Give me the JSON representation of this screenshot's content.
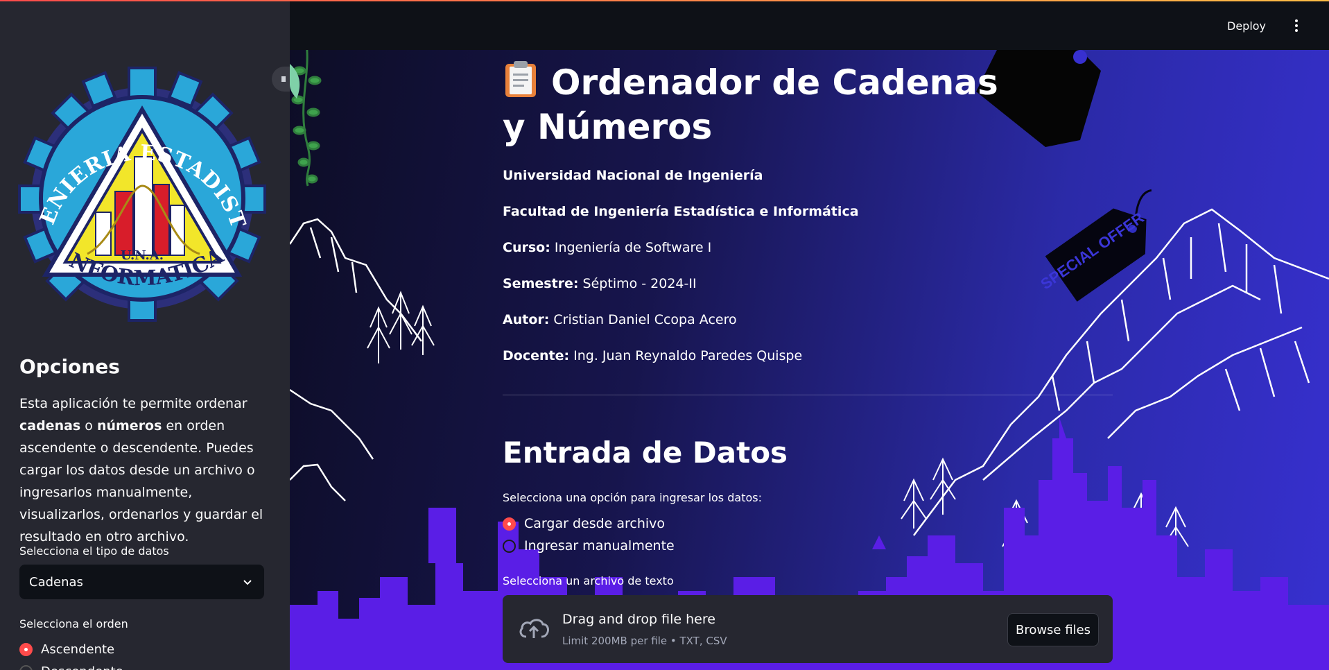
{
  "header": {
    "deploy_label": "Deploy"
  },
  "sidebar": {
    "logo": {
      "text_top": "INGENIERIA ESTADISTICA",
      "text_mid": "U.N.A.",
      "text_bottom": "INFORMATICA",
      "colors": {
        "outer": "#2c2f7a",
        "ring": "#2aa7d9",
        "yellow": "#f2e62a",
        "red": "#d81d2a"
      }
    },
    "title": "Opciones",
    "description": {
      "t1": "Esta aplicación te permite ordenar ",
      "b1": "cadenas",
      "t2": " o ",
      "b2": "números",
      "t3": " en orden ascendente o descendente. Puedes cargar los datos desde un archivo o ingresarlos manualmente, visualizarlos, ordenarlos y guardar el resultado en otro archivo."
    },
    "data_type_label": "Selecciona el tipo de datos",
    "data_type_value": "Cadenas",
    "order_label": "Selecciona el orden",
    "order_options": [
      "Ascendente",
      "Descendente"
    ],
    "order_selected": 0
  },
  "main": {
    "title": "Ordenador de Cadenas y Números",
    "title_emoji_icon": "clipboard-icon",
    "university": "Universidad Nacional de Ingeniería",
    "faculty": "Facultad de Ingeniería Estadística e Informática",
    "course": {
      "label": "Curso:",
      "value": " Ingeniería de Software I"
    },
    "semester": {
      "label": "Semestre:",
      "value": " Séptimo - 2024-II"
    },
    "author": {
      "label": "Autor:",
      "value": " Cristian Daniel Ccopa Acero"
    },
    "teacher": {
      "label": "Docente:",
      "value": " Ing. Juan Reynaldo Paredes Quispe"
    },
    "section_title": "Entrada de Datos",
    "input_prompt": "Selecciona una opción para ingresar los datos:",
    "input_options": [
      "Cargar desde archivo",
      "Ingresar manualmente"
    ],
    "input_selected": 0,
    "file_label": "Selecciona un archivo de texto",
    "upload": {
      "title": "Drag and drop file here",
      "subtitle": "Limit 200MB per file • TXT, CSV",
      "browse_label": "Browse files"
    },
    "tag_text": "SPECIAL OFFER",
    "colors": {
      "accent": "#ff4b4b",
      "city": "#5a1ee6",
      "bg_dark": "#0d0d26",
      "bg_light": "#3730d0"
    }
  }
}
